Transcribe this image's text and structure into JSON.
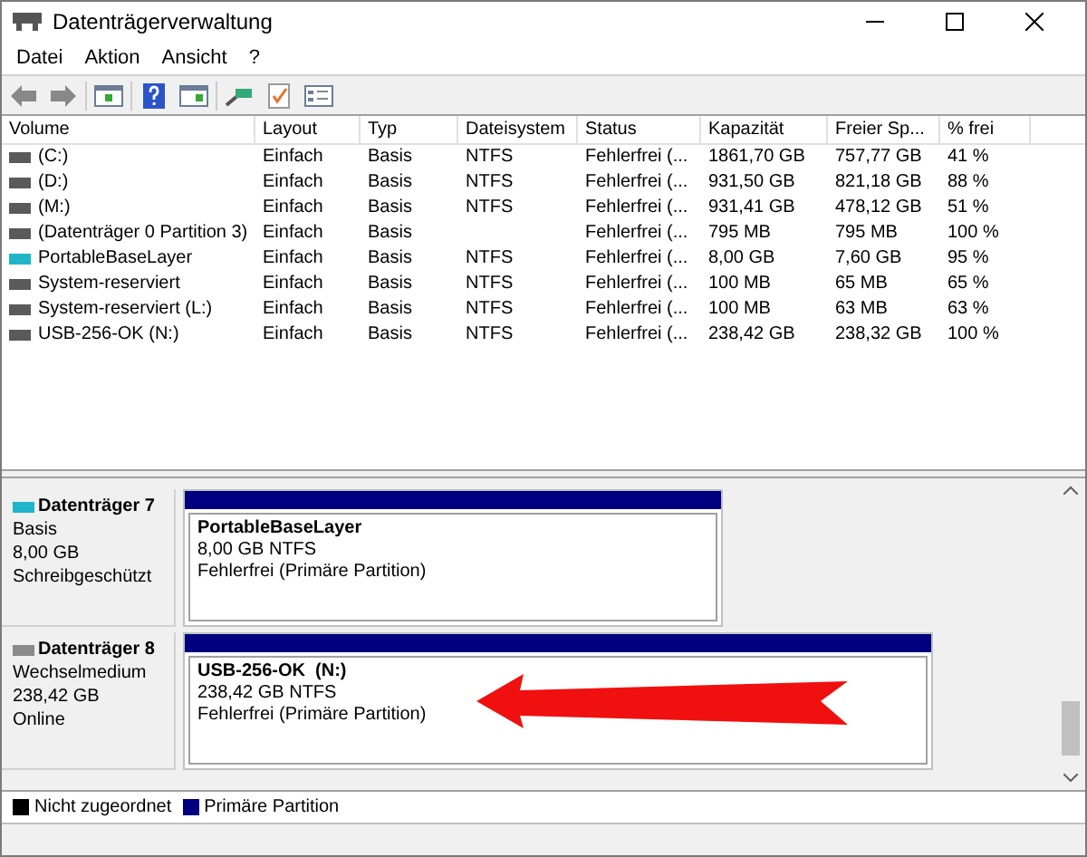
{
  "window": {
    "title": "Datenträgerverwaltung"
  },
  "menu": [
    "Datei",
    "Aktion",
    "Ansicht",
    "?"
  ],
  "table": {
    "columns": [
      "Volume",
      "Layout",
      "Typ",
      "Dateisystem",
      "Status",
      "Kapazität",
      "Freier Sp...",
      "% frei"
    ],
    "rows": [
      {
        "color": "#5a5a5a",
        "cells": [
          "(C:)",
          "Einfach",
          "Basis",
          "NTFS",
          "Fehlerfrei (...",
          "1861,70 GB",
          "757,77 GB",
          "41 %"
        ]
      },
      {
        "color": "#5a5a5a",
        "cells": [
          "(D:)",
          "Einfach",
          "Basis",
          "NTFS",
          "Fehlerfrei (...",
          "931,50 GB",
          "821,18 GB",
          "88 %"
        ]
      },
      {
        "color": "#5a5a5a",
        "cells": [
          "(M:)",
          "Einfach",
          "Basis",
          "NTFS",
          "Fehlerfrei (...",
          "931,41 GB",
          "478,12 GB",
          "51 %"
        ]
      },
      {
        "color": "#5a5a5a",
        "cells": [
          "(Datenträger 0 Partition 3)",
          "Einfach",
          "Basis",
          "",
          "Fehlerfrei (...",
          "795 MB",
          "795 MB",
          "100 %"
        ]
      },
      {
        "color": "#1fb5c8",
        "cells": [
          "PortableBaseLayer",
          "Einfach",
          "Basis",
          "NTFS",
          "Fehlerfrei (...",
          "8,00 GB",
          "7,60 GB",
          "95 %"
        ]
      },
      {
        "color": "#5a5a5a",
        "cells": [
          "System-reserviert",
          "Einfach",
          "Basis",
          "NTFS",
          "Fehlerfrei (...",
          "100 MB",
          "65 MB",
          "65 %"
        ]
      },
      {
        "color": "#5a5a5a",
        "cells": [
          "System-reserviert (L:)",
          "Einfach",
          "Basis",
          "NTFS",
          "Fehlerfrei (...",
          "100 MB",
          "63 MB",
          "63 %"
        ]
      },
      {
        "color": "#5a5a5a",
        "cells": [
          "USB-256-OK (N:)",
          "Einfach",
          "Basis",
          "NTFS",
          "Fehlerfrei (...",
          "238,42 GB",
          "238,32 GB",
          "100 %"
        ]
      }
    ]
  },
  "disks": [
    {
      "name": "Datenträger 7",
      "color": "#1fb5c8",
      "info": [
        "Basis",
        "8,00 GB",
        "Schreibgeschützt"
      ],
      "partition": {
        "name": "PortableBaseLayer",
        "size": "8,00 GB NTFS",
        "status": "Fehlerfrei (Primäre Partition)"
      }
    },
    {
      "name": "Datenträger 8",
      "color": "#8a8a8a",
      "info": [
        "Wechselmedium",
        "238,42 GB",
        "Online"
      ],
      "partition": {
        "name": "USB-256-OK  (N:)",
        "size": "238,42 GB NTFS",
        "status": "Fehlerfrei (Primäre Partition)"
      }
    }
  ],
  "legend": [
    {
      "label": "Nicht zugeordnet",
      "color": "#000000"
    },
    {
      "label": "Primäre Partition",
      "color": "#000080"
    }
  ]
}
